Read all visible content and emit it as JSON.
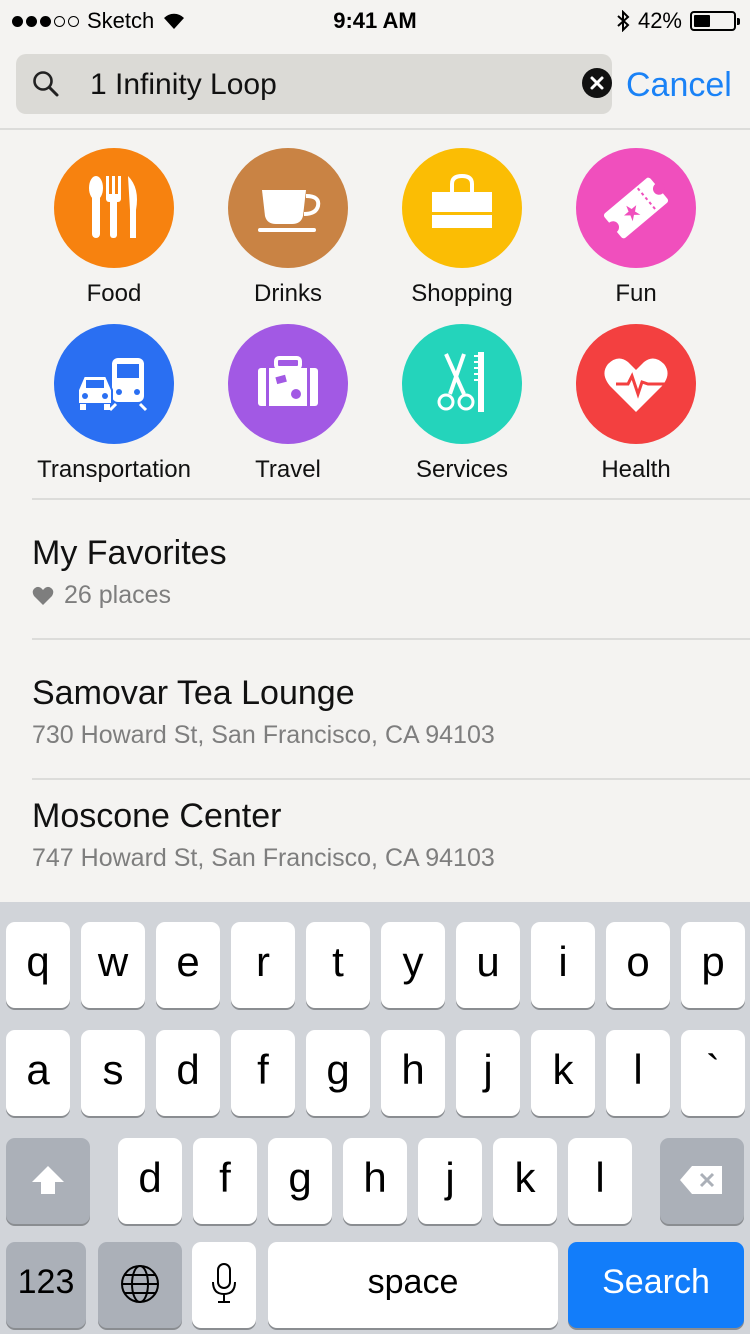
{
  "status_bar": {
    "carrier": "Sketch",
    "time": "9:41 AM",
    "battery": "42%",
    "battery_level": 0.42,
    "signal_bars_filled": 3,
    "signal_bars_total": 5,
    "icons": [
      "signal-dots-icon",
      "wifi-icon",
      "bluetooth-icon",
      "battery-icon"
    ]
  },
  "search": {
    "value": "1 Infinity Loop",
    "cancel_label": "Cancel",
    "icons": [
      "search-icon",
      "clear-icon"
    ]
  },
  "categories": [
    {
      "label": "Food",
      "color": "#f7820f",
      "icon": "food-icon"
    },
    {
      "label": "Drinks",
      "color": "#c98344",
      "icon": "drinks-icon"
    },
    {
      "label": "Shopping",
      "color": "#fbbd04",
      "icon": "shopping-icon"
    },
    {
      "label": "Fun",
      "color": "#f04fbd",
      "icon": "ticket-icon"
    },
    {
      "label": "Transportation",
      "color": "#2a6ff2",
      "icon": "transportation-icon"
    },
    {
      "label": "Travel",
      "color": "#a259e4",
      "icon": "suitcase-icon"
    },
    {
      "label": "Services",
      "color": "#24d4bb",
      "icon": "scissors-comb-icon"
    },
    {
      "label": "Health",
      "color": "#f34040",
      "icon": "heart-pulse-icon"
    }
  ],
  "favorites": {
    "title": "My Favorites",
    "count_text": "26 places",
    "icon": "heart-icon"
  },
  "results": [
    {
      "name": "Samovar Tea Lounge",
      "address": "730 Howard St, San Francisco, CA 94103"
    },
    {
      "name": "Moscone Center",
      "address": "747 Howard St, San Francisco, CA 94103"
    }
  ],
  "keyboard": {
    "row1": [
      "q",
      "w",
      "e",
      "r",
      "t",
      "y",
      "u",
      "i",
      "o",
      "p"
    ],
    "row2": [
      "a",
      "s",
      "d",
      "f",
      "g",
      "h",
      "j",
      "k",
      "l",
      "`"
    ],
    "row3": [
      "d",
      "f",
      "g",
      "h",
      "j",
      "k",
      "l"
    ],
    "numbers_label": "123",
    "space_label": "space",
    "search_label": "Search",
    "icons": [
      "shift-icon",
      "delete-icon",
      "globe-icon",
      "microphone-icon"
    ],
    "accent_color": "#127dfa"
  }
}
